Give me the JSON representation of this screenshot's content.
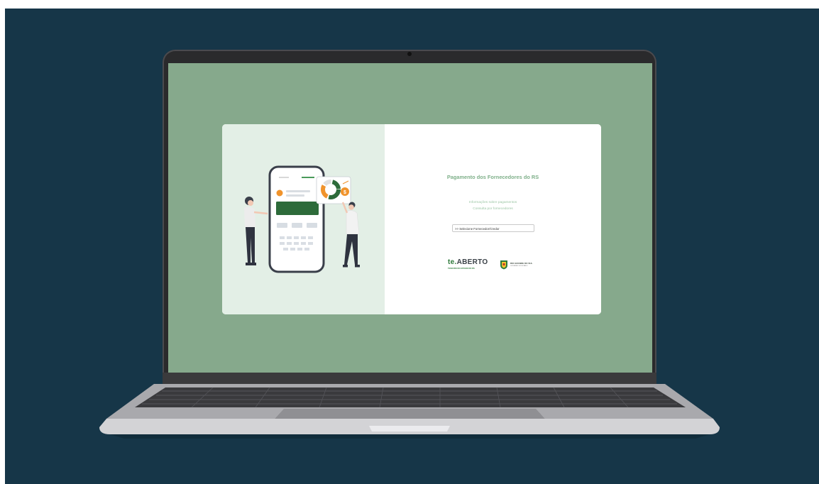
{
  "page": {
    "title": "Pagamento dos Fornecedores do RS",
    "links": [
      "Informações sobre pagamentos",
      "Consulta por fornecedores"
    ],
    "select": {
      "value": ">> Selecione Fornecedor/Credor"
    },
    "logos": {
      "te_aberto": {
        "prefix": "te.",
        "name": "ABERTO",
        "subtitle": "TESOURO DO ESTADO DO RS"
      },
      "governo": {
        "name": "RIO GRANDE DO SUL",
        "subtitle": "GOVERNO DO ESTADO"
      }
    }
  },
  "colors": {
    "backdrop": "#163648",
    "screen_bg": "#86a98c",
    "illustration_bg": "#e3efe6",
    "accent_green": "#2d6b3a",
    "title_green": "#7fb08a",
    "accent_orange": "#f0932b"
  },
  "icons": [
    "phone-illustration",
    "pie-chart-icon",
    "dollar-coin-icon",
    "woman-figure",
    "man-figure",
    "coat-of-arms-icon"
  ]
}
